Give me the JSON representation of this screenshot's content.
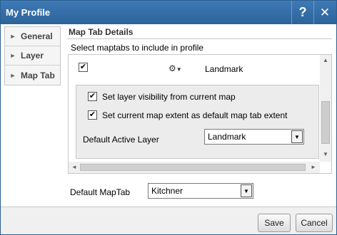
{
  "window": {
    "title": "My Profile",
    "help_glyph": "?",
    "close_glyph": "✕"
  },
  "nav": {
    "items": [
      {
        "label": "General"
      },
      {
        "label": "Layer"
      },
      {
        "label": "Map Tab"
      }
    ]
  },
  "section": {
    "title": "Map Tab Details",
    "instruction": "Select maptabs to include in profile"
  },
  "maptab": {
    "name": "Landmark",
    "checked": true,
    "options": [
      {
        "label": "Set layer visibility from current map",
        "checked": true
      },
      {
        "label": "Set current map extent as default map tab extent",
        "checked": true
      }
    ],
    "default_layer_label": "Default Active Layer",
    "default_layer_value": "Landmark"
  },
  "default_maptab": {
    "label": "Default MapTab",
    "value": "Kitchner"
  },
  "footer": {
    "save_label": "Save",
    "cancel_label": "Cancel"
  }
}
